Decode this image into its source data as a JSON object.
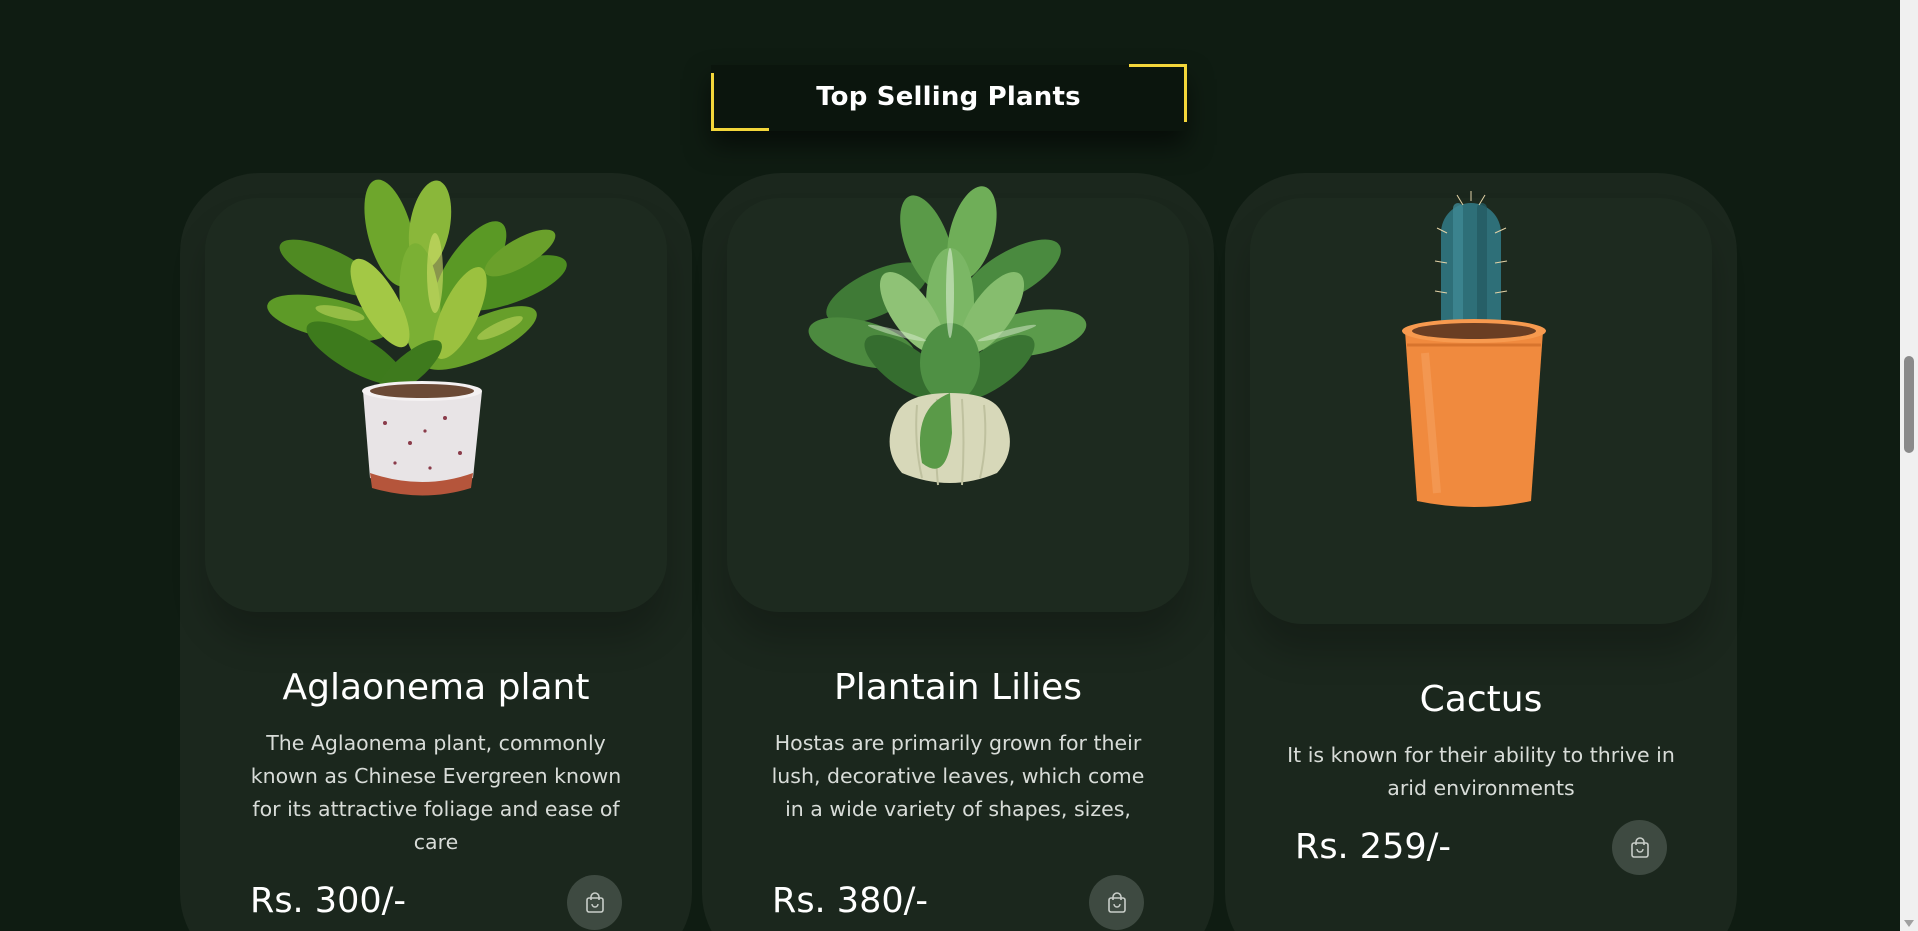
{
  "section": {
    "title": "Top Selling Plants",
    "accent_color": "#f3d63a"
  },
  "products": [
    {
      "name": "Aglaonema plant",
      "description": "The Aglaonema plant, commonly known as Chinese Evergreen known for its attractive foliage and ease of care",
      "price": "Rs. 300/-",
      "image_icon": "aglaonema-plant-image",
      "cart_icon": "shopping-bag-icon"
    },
    {
      "name": "Plantain Lilies",
      "description": "Hostas are primarily grown for their lush, decorative leaves, which come in a wide variety of shapes, sizes,",
      "price": "Rs. 380/-",
      "image_icon": "hosta-plant-image",
      "cart_icon": "shopping-bag-icon"
    },
    {
      "name": "Cactus",
      "description": "It is known for their ability to thrive in arid environments",
      "price": "Rs. 259/-",
      "image_icon": "cactus-plant-image",
      "cart_icon": "shopping-bag-icon"
    }
  ],
  "colors": {
    "background": "#0f1c12",
    "card": "#1b271d",
    "cart_button": "#3e4a41"
  }
}
